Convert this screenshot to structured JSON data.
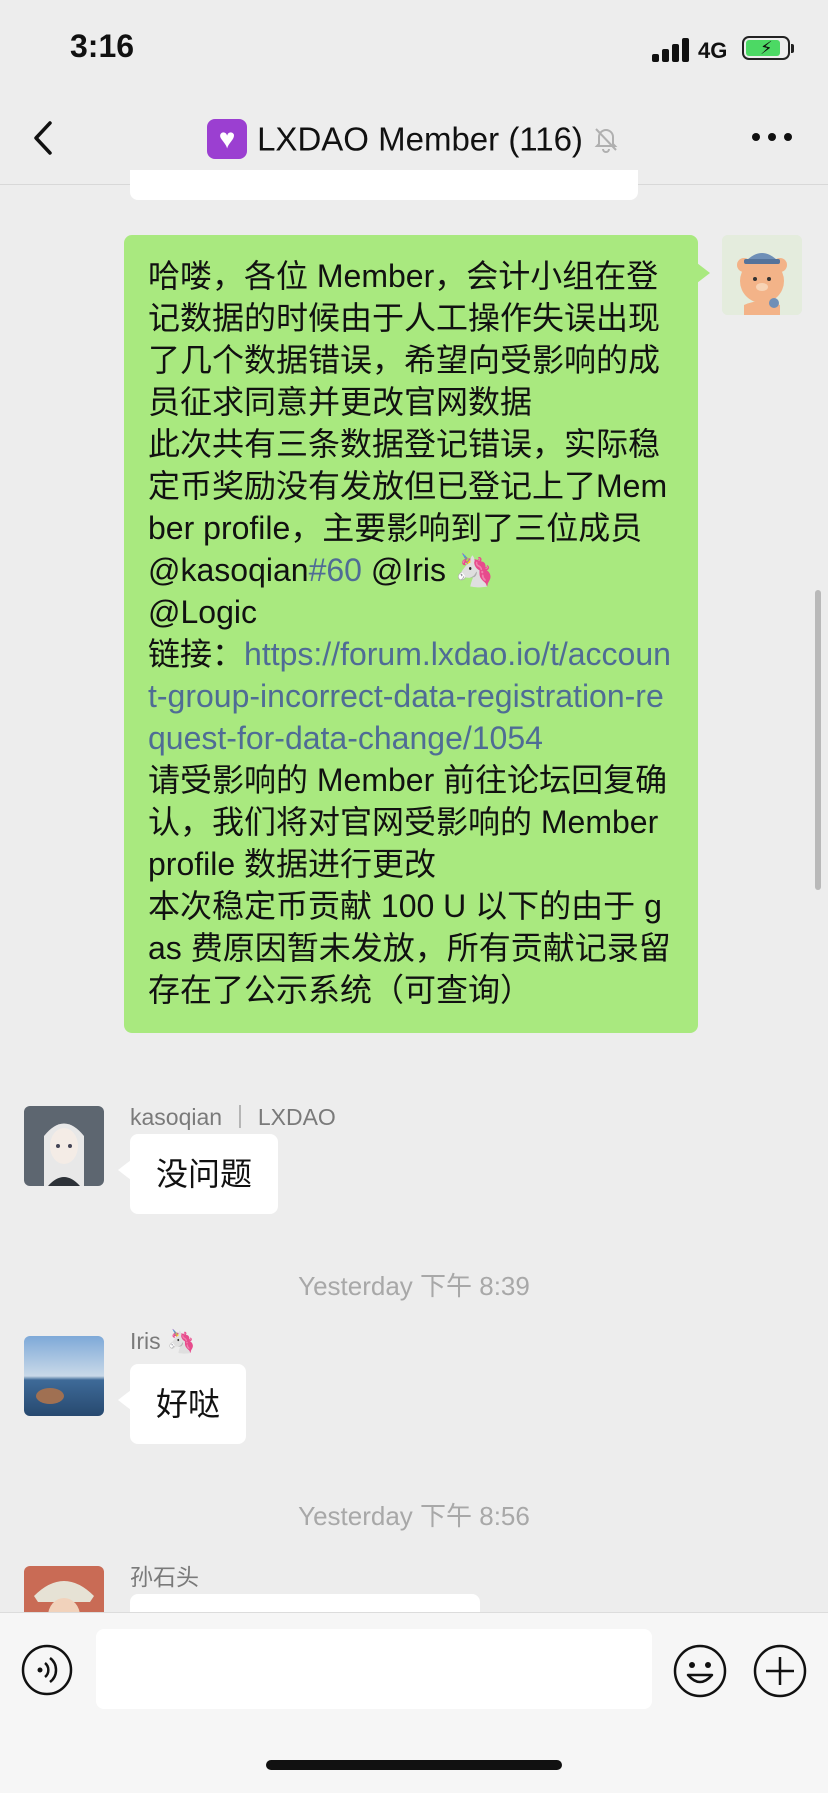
{
  "status_bar": {
    "time": "3:16",
    "network": "4G"
  },
  "header": {
    "title": "LXDAO Member (116)"
  },
  "messages": {
    "self_message": {
      "paragraph1": "哈喽，各位 Member，会计小组在登记数据的时候由于人工操作失误出现了几个数据错误，希望向受影响的成员征求同意并更改官网数据",
      "paragraph2_text": "此次共有三条数据登记错误，实际稳定币奖励没有发放但已登记上了Member profile，主要影响到了三位成员 @kasoqian",
      "paragraph2_tag": "#60",
      "paragraph2_mention_iris": " @Iris 🦄",
      "paragraph2_mention_logic": "@Logic",
      "link_label": "链接：",
      "link_url": "https://forum.lxdao.io/t/account-group-incorrect-data-registration-request-for-data-change/1054",
      "paragraph3": "请受影响的 Member 前往论坛回复确认，我们将对官网受影响的 Member profile 数据进行更改",
      "paragraph4": "本次稳定币贡献 100 U 以下的由于 gas 费原因暂未发放，所有贡献记录留存在了公示系统（可查询）"
    },
    "reply1": {
      "sender": "kasoqian ｜ LXDAO",
      "text": "没问题"
    },
    "timestamp1": "Yesterday 下午 8:39",
    "reply2": {
      "sender": "Iris 🦄",
      "text": "好哒"
    },
    "timestamp2": "Yesterday 下午 8:56",
    "reply3": {
      "sender": "孙石头"
    }
  },
  "input": {
    "value": "",
    "placeholder": ""
  }
}
